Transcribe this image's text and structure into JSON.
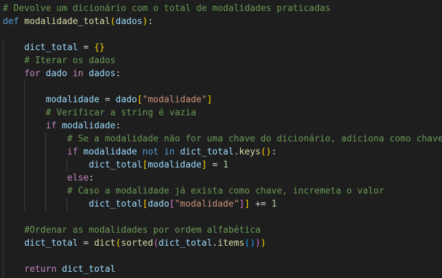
{
  "editor": {
    "lines": [
      {
        "tokens": [
          {
            "t": "# Devolve um dicionário com o total de modalidades praticadas",
            "c": "comment"
          }
        ]
      },
      {
        "tokens": [
          {
            "t": "def",
            "c": "keyword"
          },
          {
            "t": " ",
            "c": "op"
          },
          {
            "t": "modalidade_total",
            "c": "func"
          },
          {
            "t": "(",
            "c": "b1"
          },
          {
            "t": "dados",
            "c": "var"
          },
          {
            "t": ")",
            "c": "b1"
          },
          {
            "t": ":",
            "c": "op"
          }
        ]
      },
      {
        "tokens": []
      },
      {
        "tokens": [
          {
            "t": "    ",
            "c": "op"
          },
          {
            "t": "dict_total",
            "c": "var"
          },
          {
            "t": " = ",
            "c": "op"
          },
          {
            "t": "{}",
            "c": "b1"
          }
        ]
      },
      {
        "tokens": [
          {
            "t": "    ",
            "c": "op"
          },
          {
            "t": "# Iterar os dados",
            "c": "comment"
          }
        ]
      },
      {
        "tokens": [
          {
            "t": "    ",
            "c": "op"
          },
          {
            "t": "for",
            "c": "control"
          },
          {
            "t": " ",
            "c": "op"
          },
          {
            "t": "dado",
            "c": "var"
          },
          {
            "t": " ",
            "c": "op"
          },
          {
            "t": "in",
            "c": "control"
          },
          {
            "t": " ",
            "c": "op"
          },
          {
            "t": "dados",
            "c": "var"
          },
          {
            "t": ":",
            "c": "op"
          }
        ]
      },
      {
        "tokens": []
      },
      {
        "tokens": [
          {
            "t": "        ",
            "c": "op"
          },
          {
            "t": "modalidade",
            "c": "var"
          },
          {
            "t": " = ",
            "c": "op"
          },
          {
            "t": "dado",
            "c": "var"
          },
          {
            "t": "[",
            "c": "b1"
          },
          {
            "t": "\"modalidade\"",
            "c": "str"
          },
          {
            "t": "]",
            "c": "b1"
          }
        ]
      },
      {
        "tokens": [
          {
            "t": "        ",
            "c": "op"
          },
          {
            "t": "# Verificar a string é vazia",
            "c": "comment"
          }
        ]
      },
      {
        "tokens": [
          {
            "t": "        ",
            "c": "op"
          },
          {
            "t": "if",
            "c": "control"
          },
          {
            "t": " ",
            "c": "op"
          },
          {
            "t": "modalidade",
            "c": "var"
          },
          {
            "t": ":",
            "c": "op"
          }
        ]
      },
      {
        "tokens": [
          {
            "t": "            ",
            "c": "op"
          },
          {
            "t": "# Se a modalidade não for uma chave do dicionário, adiciona como chave",
            "c": "comment"
          }
        ]
      },
      {
        "tokens": [
          {
            "t": "            ",
            "c": "op"
          },
          {
            "t": "if",
            "c": "control"
          },
          {
            "t": " ",
            "c": "op"
          },
          {
            "t": "modalidade",
            "c": "var"
          },
          {
            "t": " ",
            "c": "op"
          },
          {
            "t": "not",
            "c": "keyword"
          },
          {
            "t": " ",
            "c": "op"
          },
          {
            "t": "in",
            "c": "keyword"
          },
          {
            "t": " ",
            "c": "op"
          },
          {
            "t": "dict_total",
            "c": "var"
          },
          {
            "t": ".",
            "c": "op"
          },
          {
            "t": "keys",
            "c": "func"
          },
          {
            "t": "()",
            "c": "b1"
          },
          {
            "t": ":",
            "c": "op"
          }
        ]
      },
      {
        "tokens": [
          {
            "t": "                ",
            "c": "op"
          },
          {
            "t": "dict_total",
            "c": "var"
          },
          {
            "t": "[",
            "c": "b1"
          },
          {
            "t": "modalidade",
            "c": "var"
          },
          {
            "t": "]",
            "c": "b1"
          },
          {
            "t": " = ",
            "c": "op"
          },
          {
            "t": "1",
            "c": "num"
          }
        ]
      },
      {
        "tokens": [
          {
            "t": "            ",
            "c": "op"
          },
          {
            "t": "else",
            "c": "control"
          },
          {
            "t": ":",
            "c": "op"
          }
        ]
      },
      {
        "tokens": [
          {
            "t": "            ",
            "c": "op"
          },
          {
            "t": "# Caso a modalidade já exista como chave, incremeta o valor",
            "c": "comment"
          }
        ]
      },
      {
        "tokens": [
          {
            "t": "                ",
            "c": "op"
          },
          {
            "t": "dict_total",
            "c": "var"
          },
          {
            "t": "[",
            "c": "b1"
          },
          {
            "t": "dado",
            "c": "var"
          },
          {
            "t": "[",
            "c": "b2"
          },
          {
            "t": "\"modalidade\"",
            "c": "str"
          },
          {
            "t": "]",
            "c": "b2"
          },
          {
            "t": "]",
            "c": "b1"
          },
          {
            "t": " += ",
            "c": "op"
          },
          {
            "t": "1",
            "c": "num"
          }
        ]
      },
      {
        "tokens": []
      },
      {
        "tokens": [
          {
            "t": "    ",
            "c": "op"
          },
          {
            "t": "#Ordenar as modalidades por ordem alfabética",
            "c": "comment"
          }
        ]
      },
      {
        "tokens": [
          {
            "t": "    ",
            "c": "op"
          },
          {
            "t": "dict_total",
            "c": "var"
          },
          {
            "t": " = ",
            "c": "op"
          },
          {
            "t": "dict",
            "c": "func"
          },
          {
            "t": "(",
            "c": "b1"
          },
          {
            "t": "sorted",
            "c": "func"
          },
          {
            "t": "(",
            "c": "b2"
          },
          {
            "t": "dict_total",
            "c": "var"
          },
          {
            "t": ".",
            "c": "op"
          },
          {
            "t": "items",
            "c": "func"
          },
          {
            "t": "()",
            "c": "b3"
          },
          {
            "t": ")",
            "c": "b2"
          },
          {
            "t": ")",
            "c": "b1"
          }
        ]
      },
      {
        "tokens": []
      },
      {
        "tokens": [
          {
            "t": "    ",
            "c": "op"
          },
          {
            "t": "return",
            "c": "control"
          },
          {
            "t": " ",
            "c": "op"
          },
          {
            "t": "dict_total",
            "c": "var"
          }
        ]
      }
    ]
  }
}
